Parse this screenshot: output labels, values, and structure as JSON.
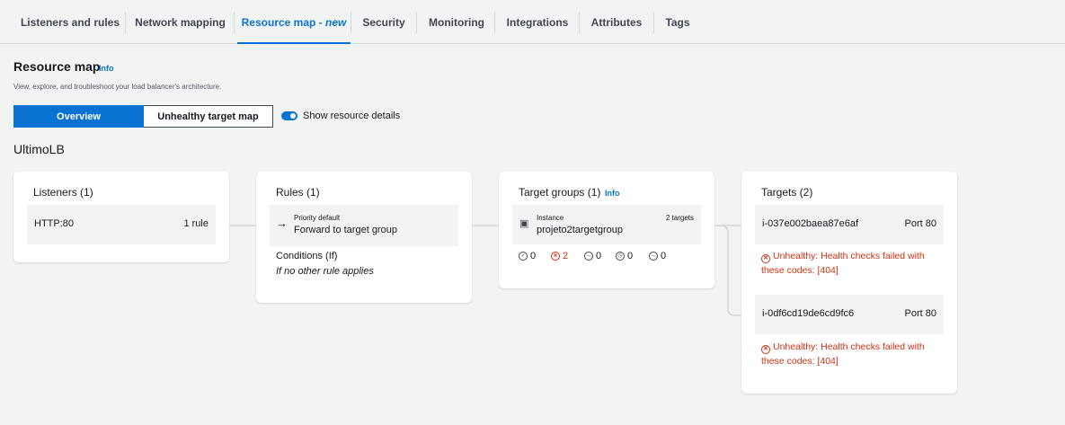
{
  "tabs": [
    {
      "label": "Listeners and rules"
    },
    {
      "label": "Network mapping"
    },
    {
      "label": "Resource map - ",
      "suffix": "new"
    },
    {
      "label": "Security"
    },
    {
      "label": "Monitoring"
    },
    {
      "label": "Integrations"
    },
    {
      "label": "Attributes"
    },
    {
      "label": "Tags"
    }
  ],
  "header": {
    "title": "Resource map",
    "info": "Info",
    "description": "View, explore, and troubleshoot your load balancer's architecture."
  },
  "view": {
    "overview": "Overview",
    "unhealthy": "Unhealthy target map",
    "toggle_label": "Show resource details",
    "toggle_on": true
  },
  "lb_name": "UltimoLB",
  "listeners": {
    "title": "Listeners (1)",
    "items": [
      {
        "name": "HTTP:80",
        "rules": "1 rule"
      }
    ]
  },
  "rules": {
    "title": "Rules (1)",
    "priority": "Priority default",
    "action": "Forward to target group",
    "conditions_label": "Conditions (If)",
    "conditions_value": "If no other rule applies"
  },
  "target_groups": {
    "title": "Target groups (1)",
    "info": "Info",
    "type": "Instance",
    "count": "2 targets",
    "name": "projeto2targetgroup",
    "stats": {
      "healthy": "0",
      "unhealthy": "2",
      "unused": "0",
      "draining": "0",
      "other": "0"
    }
  },
  "targets": {
    "title": "Targets (2)",
    "items": [
      {
        "id": "i-037e002baea87e6af",
        "port": "Port 80",
        "status_line1": "Unhealthy: Health checks failed with",
        "status_line2": "these codes: [404]"
      },
      {
        "id": "i-0df6cd19de6cd9fc6",
        "port": "Port 80",
        "status_line1": "Unhealthy: Health checks failed with",
        "status_line2": "these codes: [404]"
      }
    ]
  },
  "colors": {
    "accent": "#0972d3",
    "error": "#d13212",
    "background": "#f2f3f3"
  }
}
